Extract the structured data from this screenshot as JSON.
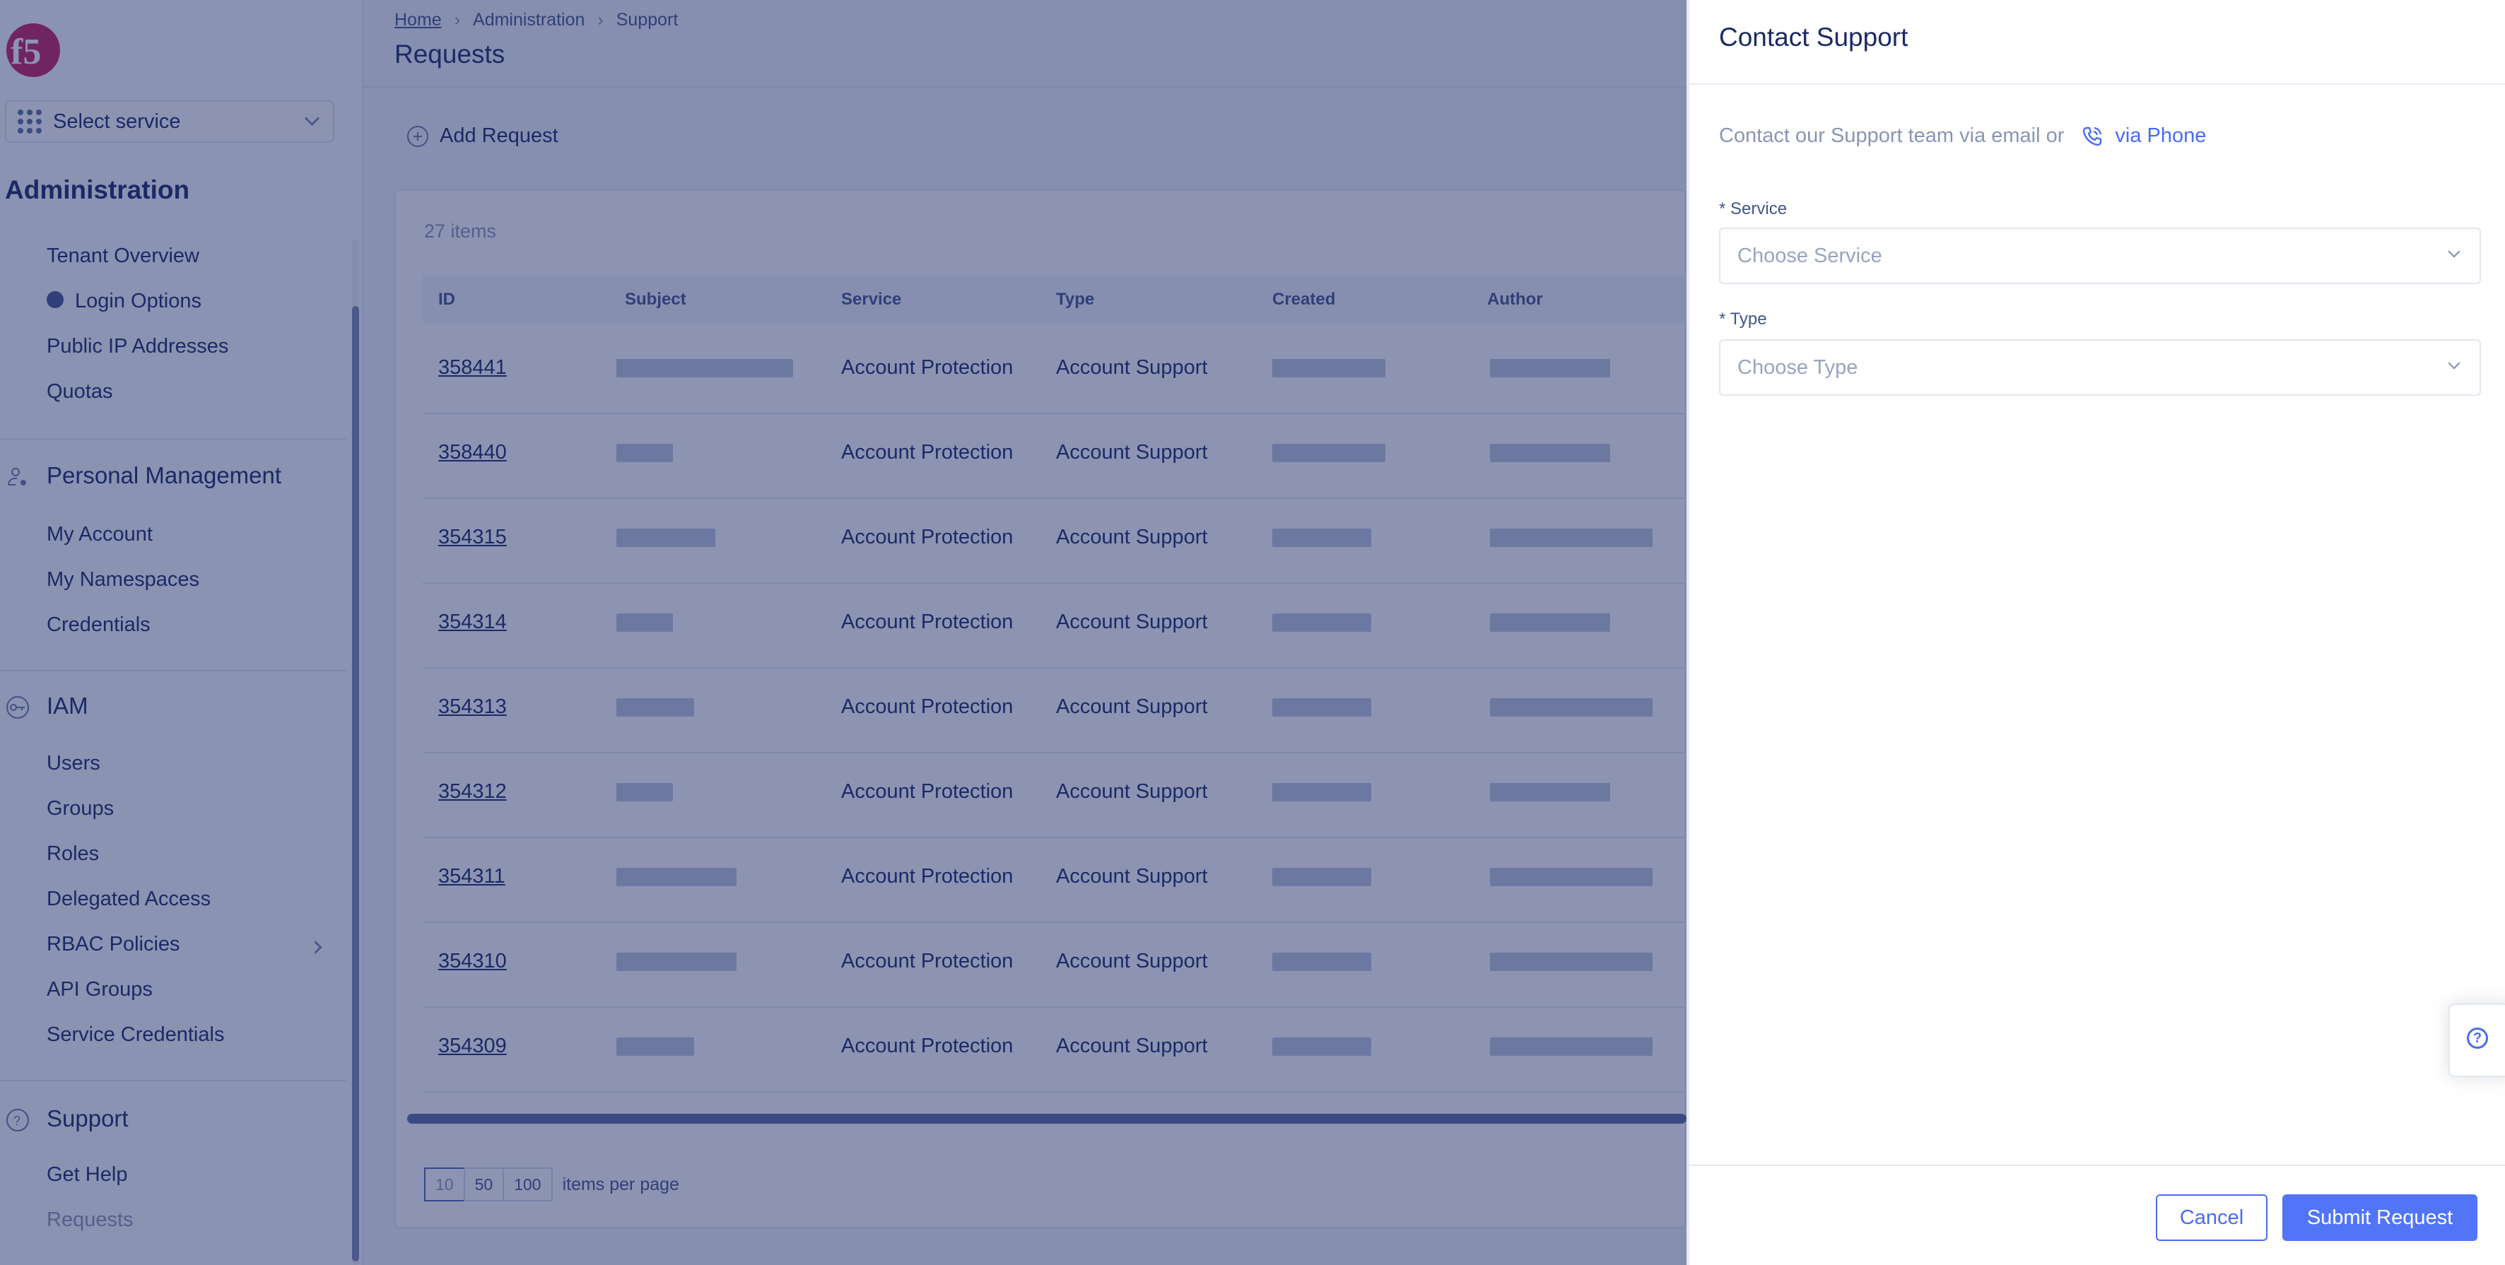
{
  "sidebar": {
    "service_select": "Select service",
    "title": "Administration",
    "admin_items": [
      "Tenant Overview",
      "Login Options",
      "Public IP Addresses",
      "Quotas"
    ],
    "sections": [
      {
        "title": "Personal Management",
        "icon": "user-gear-icon",
        "items": [
          "My Account",
          "My Namespaces",
          "Credentials"
        ]
      },
      {
        "title": "IAM",
        "icon": "key-icon",
        "items": [
          "Users",
          "Groups",
          "Roles",
          "Delegated Access",
          "RBAC Policies",
          "API Groups",
          "Service Credentials"
        ]
      },
      {
        "title": "Support",
        "icon": "question-circle-icon",
        "items": [
          "Get Help",
          "Requests"
        ]
      }
    ]
  },
  "breadcrumb": [
    "Home",
    "Administration",
    "Support"
  ],
  "page_title": "Requests",
  "add_request_label": "Add Request",
  "table": {
    "count": "27 items",
    "columns": [
      "ID",
      "Subject",
      "Service",
      "Type",
      "Created",
      "Author"
    ],
    "rows": [
      {
        "id": "358441",
        "service": "Account Protection",
        "type": "Account Support"
      },
      {
        "id": "358440",
        "service": "Account Protection",
        "type": "Account Support"
      },
      {
        "id": "354315",
        "service": "Account Protection",
        "type": "Account Support"
      },
      {
        "id": "354314",
        "service": "Account Protection",
        "type": "Account Support"
      },
      {
        "id": "354313",
        "service": "Account Protection",
        "type": "Account Support"
      },
      {
        "id": "354312",
        "service": "Account Protection",
        "type": "Account Support"
      },
      {
        "id": "354311",
        "service": "Account Protection",
        "type": "Account Support"
      },
      {
        "id": "354310",
        "service": "Account Protection",
        "type": "Account Support"
      },
      {
        "id": "354309",
        "service": "Account Protection",
        "type": "Account Support"
      }
    ]
  },
  "pagination": {
    "options": [
      "10",
      "50",
      "100"
    ],
    "selected": "10",
    "label": "items per page"
  },
  "modal": {
    "title": "Contact Support",
    "intro": "Contact our Support team via email or",
    "phone_link": "via Phone",
    "service_label": "* Service",
    "service_placeholder": "Choose Service",
    "type_label": "* Type",
    "type_placeholder": "Choose Type",
    "cancel": "Cancel",
    "submit": "Submit Request"
  },
  "colors": {
    "accent": "#5275f7",
    "link": "#4a6cf0",
    "brand": "#8b1c4a",
    "text": "#1b2a66"
  }
}
